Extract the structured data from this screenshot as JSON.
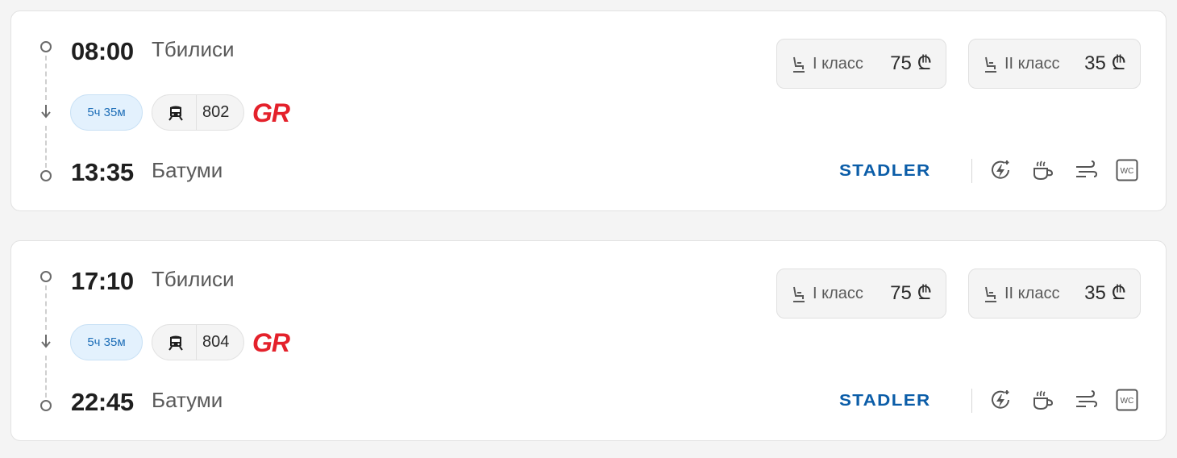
{
  "trips": [
    {
      "departure_time": "08:00",
      "departure_city": "Тбилиси",
      "arrival_time": "13:35",
      "arrival_city": "Батуми",
      "duration": "5ч 35м",
      "train_number": "802",
      "operator_logo": "GR",
      "manufacturer_logo": "STADLER",
      "classes": [
        {
          "label": "I класс",
          "price": "75 ₾"
        },
        {
          "label": "II класс",
          "price": "35 ₾"
        }
      ],
      "amenities": [
        "charging-icon",
        "coffee-icon",
        "air-conditioning-icon",
        "wc-icon"
      ]
    },
    {
      "departure_time": "17:10",
      "departure_city": "Тбилиси",
      "arrival_time": "22:45",
      "arrival_city": "Батуми",
      "duration": "5ч 35м",
      "train_number": "804",
      "operator_logo": "GR",
      "manufacturer_logo": "STADLER",
      "classes": [
        {
          "label": "I класс",
          "price": "75 ₾"
        },
        {
          "label": "II класс",
          "price": "35 ₾"
        }
      ],
      "amenities": [
        "charging-icon",
        "coffee-icon",
        "air-conditioning-icon",
        "wc-icon"
      ]
    }
  ],
  "colors": {
    "operator_red": "#e4212b",
    "stadler_blue": "#0b5da8",
    "duration_pill_bg": "#e3f1fd",
    "duration_text": "#1f6fb8"
  }
}
